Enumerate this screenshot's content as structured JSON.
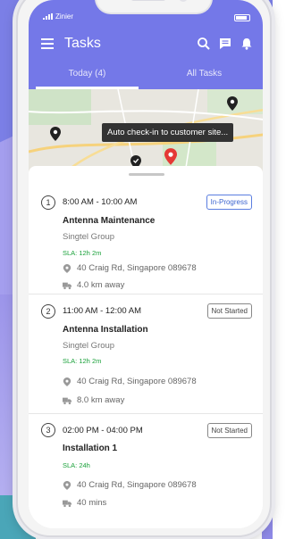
{
  "status_bar": {
    "carrier": "Zinier"
  },
  "appbar": {
    "title": "Tasks"
  },
  "tabs": [
    {
      "label": "Today (4)",
      "active": true
    },
    {
      "label": "All Tasks",
      "active": false
    }
  ],
  "map": {
    "tooltip": "Auto check-in to customer site..."
  },
  "tasks": [
    {
      "index": "1",
      "time": "8:00 AM - 10:00 AM",
      "status": "In-Progress",
      "name": "Antenna Maintenance",
      "company": "Singtel Group",
      "sla": "SLA: 12h 2m",
      "address": "40 Craig Rd, Singapore 089678",
      "distance": "4.0 km away"
    },
    {
      "index": "2",
      "time": "11:00 AM - 12:00 AM",
      "status": "Not Started",
      "name": "Antenna Installation",
      "company": "Singtel Group",
      "sla": "SLA: 12h 2m",
      "address": "40 Craig Rd, Singapore 089678",
      "distance": "8.0 km away"
    },
    {
      "index": "3",
      "time": "02:00 PM - 04:00 PM",
      "status": "Not Started",
      "name": "Installation 1",
      "sla": "SLA: 24h",
      "address": "40 Craig Rd, Singapore 089678",
      "distance": "40 mins"
    }
  ],
  "colors": {
    "brand": "#7478e8",
    "sla_green": "#1aa13a",
    "in_progress": "#3b63cf"
  }
}
